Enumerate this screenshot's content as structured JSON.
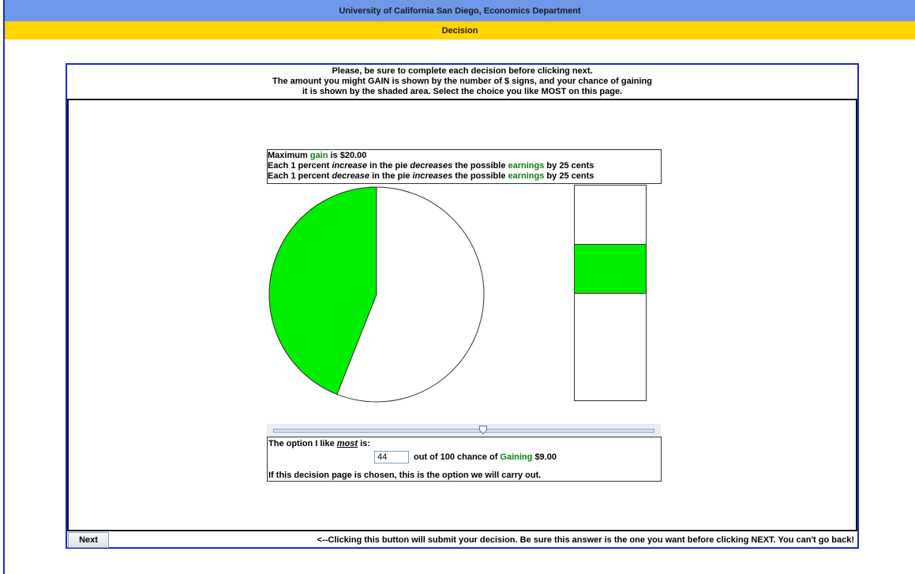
{
  "header": {
    "title": "University of California San Diego, Economics Department",
    "subtitle": "Decision"
  },
  "instructions": {
    "line1": "Please, be sure to complete each decision before clicking next.",
    "line2": "The amount you might GAIN is shown by the number of $ signs, and your chance of gaining",
    "line3": "it is shown by the shaded area. Select the choice you like MOST on this page."
  },
  "info": {
    "line1_a": "Maximum ",
    "line1_gain": "gain",
    "line1_b": " is $20.00",
    "line2_a": "Each 1 percent ",
    "line2_increase": "increase",
    "line2_b": " in the pie ",
    "line2_decreases": "decreases",
    "line2_c": " the possible ",
    "line2_earnings": "earnings",
    "line2_d": " by 25 cents",
    "line3_a": "Each 1 percent ",
    "line3_decrease": "decrease",
    "line3_b": " in the pie ",
    "line3_increases": "increases",
    "line3_c": " the possible ",
    "line3_earnings": "earnings",
    "line3_d": " by 25 cents"
  },
  "choice": {
    "probability_percent": 44,
    "bar_fill_top_fraction": 0.27,
    "bar_fill_bottom_fraction": 0.5,
    "slider_fraction": 0.55,
    "green_color": "#00ee00"
  },
  "option": {
    "head_a": "The option I like ",
    "head_most": "most",
    "head_b": " is:",
    "value": "44",
    "mid_a": "out of 100 chance of ",
    "mid_gaining": "Gaining",
    "mid_amount": "$9.00",
    "foot": "If this decision page is chosen, this is the option we will carry out."
  },
  "footer": {
    "next_label": "Next",
    "note": "<--Clicking this button will submit your decision.  Be sure this answer is the one you want before clicking NEXT.  You can't go back!"
  }
}
